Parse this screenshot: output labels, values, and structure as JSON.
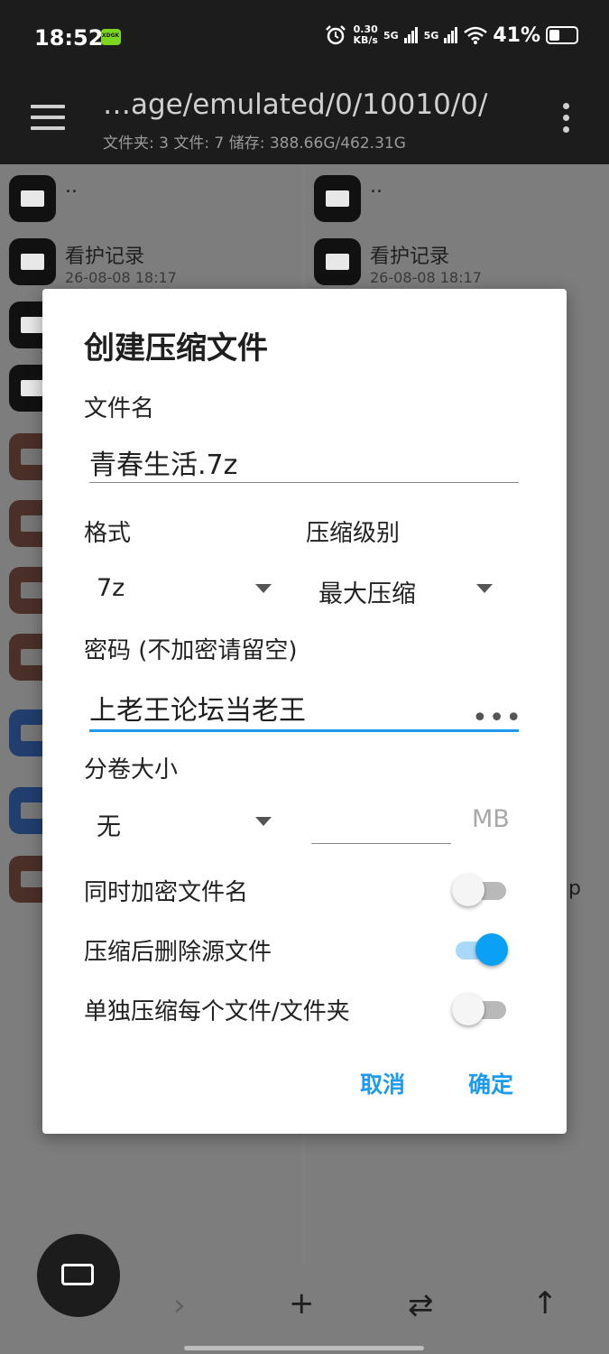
{
  "status_bar": {
    "time": "18:52",
    "badge_text": "XDGK",
    "net_speed_value": "0.30",
    "net_speed_unit": "KB/s",
    "sim1": "5G",
    "sim2": "5G",
    "battery_percent": "41%",
    "battery_level": 0.41
  },
  "toolbar": {
    "path_title": "…age/emulated/0/10010/0/",
    "stats": "文件夹: 3  文件: 7  储存: 388.66G/462.31G"
  },
  "left_pane": {
    "rows": [
      {
        "kind": "folder",
        "name": "..",
        "meta": ""
      },
      {
        "kind": "folder",
        "name": "看护记录",
        "meta": "26-08-08 18:17"
      },
      {
        "kind": "folder",
        "name": "",
        "meta": ""
      },
      {
        "kind": "folder",
        "name": "",
        "meta": ""
      },
      {
        "kind": "archive",
        "name": "",
        "meta": ""
      },
      {
        "kind": "archive",
        "name": "",
        "meta": ""
      },
      {
        "kind": "archive",
        "name": "",
        "meta": ""
      },
      {
        "kind": "archive",
        "name": "",
        "meta": ""
      },
      {
        "kind": "doc",
        "name": "",
        "meta": ""
      },
      {
        "kind": "doc",
        "name": "",
        "meta": ""
      },
      {
        "kind": "archive",
        "name": "",
        "meta": ""
      }
    ]
  },
  "right_pane": {
    "rows": [
      {
        "kind": "folder",
        "name": "..",
        "meta": ""
      },
      {
        "kind": "folder",
        "name": "看护记录",
        "meta": "26-08-08 18:17"
      }
    ],
    "edge_text": "p"
  },
  "dialog": {
    "title": "创建压缩文件",
    "filename_label": "文件名",
    "filename_value": "青春生活.7z",
    "format_label": "格式",
    "format_value": "7z",
    "level_label": "压缩级别",
    "level_value": "最大压缩",
    "password_label": "密码 (不加密请留空)",
    "password_value": "上老王论坛当老王",
    "password_toggle": "•••",
    "volume_label": "分卷大小",
    "volume_value": "无",
    "volume_unit": "MB",
    "toggles": [
      {
        "label": "同时加密文件名",
        "on": false
      },
      {
        "label": "压缩后删除源文件",
        "on": true
      },
      {
        "label": "单独压缩每个文件/文件夹",
        "on": false
      }
    ],
    "cancel_label": "取消",
    "ok_label": "确定",
    "accent_color": "#1e9bf0"
  },
  "bottom_bar": {
    "back": "‹",
    "forward": "›",
    "add": "+",
    "swap": "⇄",
    "up": "↑"
  }
}
